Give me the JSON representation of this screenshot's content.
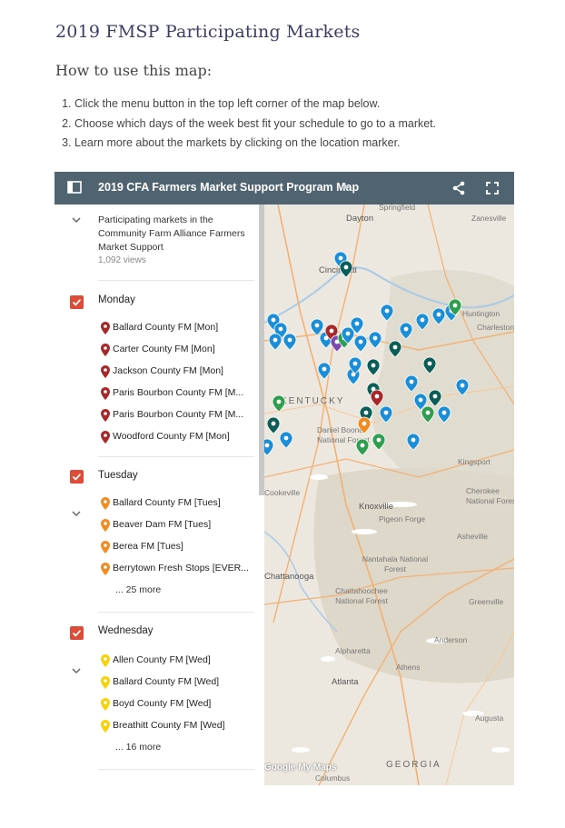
{
  "page": {
    "title": "2019 FMSP Participating Markets",
    "howto_title": "How to use this map:",
    "steps": [
      "Click the menu button in the top left corner of the map below.",
      "Choose which days of the week best fit your schedule to go to a market.",
      "Learn more about the markets by clicking on the location marker."
    ]
  },
  "map_header": {
    "title": "2019 CFA Farmers Market Support Program Map",
    "star": "★",
    "icons": [
      "sidebar-toggle-icon",
      "share-icon",
      "fullscreen-icon"
    ]
  },
  "sidebar": {
    "description": "Participating markets in the Community Farm Alliance Farmers Market Support",
    "views": "1,092 views",
    "layers": [
      {
        "name": "Monday",
        "pin_color": "#a8282a",
        "items": [
          "Ballard County FM [Mon]",
          "Carter County FM [Mon]",
          "Jackson County FM [Mon]",
          "Paris Bourbon County FM [M...",
          "Paris Bourbon County FM [M...",
          "Woodford County FM [Mon]"
        ],
        "more": ""
      },
      {
        "name": "Tuesday",
        "pin_color": "#f08c22",
        "items": [
          "Ballard County FM [Tues]",
          "Beaver Dam FM [Tues]",
          "Berea FM [Tues]",
          "Berrytown Fresh Stops [EVER..."
        ],
        "more": "... 25 more"
      },
      {
        "name": "Wednesday",
        "pin_color": "#f5d20a",
        "items": [
          "Allen County FM [Wed]",
          "Ballard County FM [Wed]",
          "Boyd County FM [Wed]",
          "Breathitt County FM [Wed]"
        ],
        "more": "... 16 more"
      }
    ]
  },
  "map": {
    "labels": {
      "springfield": "Springfield",
      "dayton": "Dayton",
      "zanesville": "Zanesville",
      "cincinnati": "Cincinnati",
      "huntington": "Huntington",
      "charleston": "Charleston",
      "kentucky": "KENTUCKY",
      "daniel_boone": "Daniel Boone National Forest",
      "kingsport": "Kingsport",
      "cookeville": "Cookeville",
      "knoxville": "Knoxville",
      "pigeon_forge": "Pigeon Forge",
      "cherokee": "Cherokee National Forest",
      "asheville": "Asheville",
      "chattanooga": "Chattanooga",
      "nantahala": "Nantahala National Forest",
      "chattahoochee": "Chattahoochee National Forest",
      "greenville": "Greenville",
      "alpharetta": "Alpharetta",
      "athens": "Athens",
      "anderson": "Anderson",
      "atlanta": "Atlanta",
      "augusta": "Augusta",
      "georgia": "GEORGIA",
      "columbus": "Columbus"
    },
    "attribution": "Google My Maps",
    "colors": {
      "header": "#4f6470",
      "checkbox": "#dd4b39",
      "blue_pin": "#1a8fd8",
      "teal_pin": "#0b5e57",
      "green_pin": "#2f9f4f",
      "purple_pin": "#7b4bb0"
    }
  }
}
